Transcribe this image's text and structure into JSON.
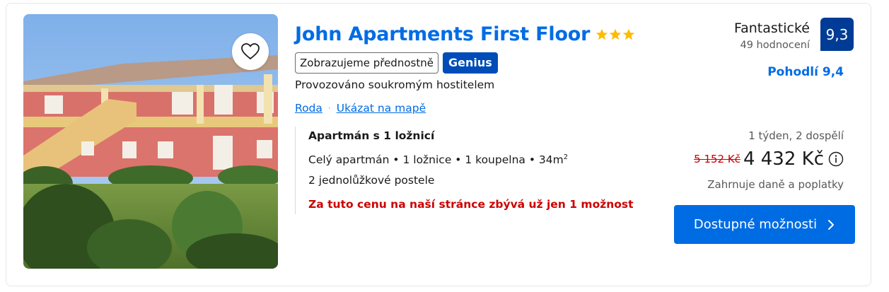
{
  "listing": {
    "title": "John Apartments First Floor",
    "stars": 3,
    "preferred_badge": "Zobrazujeme přednostně",
    "genius_badge": "Genius",
    "host_text": "Provozováno soukromým hostitelem",
    "location_link": "Roda",
    "map_link": "Ukázat na mapě"
  },
  "room": {
    "title": "Apartmán s 1 ložnicí",
    "spec_main": "Celý apartmán • 1 ložnice • 1 koupelna • 34m",
    "spec_sup": "2",
    "beds": "2 jednolůžkové postele",
    "urgency": "Za tuto cenu na naší stránce zbývá už jen 1 možnost"
  },
  "rating": {
    "label": "Fantastické",
    "count": "49 hodnocení",
    "score": "9,3",
    "comfort": "Pohodlí 9,4"
  },
  "pricing": {
    "stay_info": "1 týden, 2 dospělí",
    "old_price": "5 152 Kč",
    "new_price": "4 432 Kč",
    "taxes": "Zahrnuje daně a poplatky"
  },
  "cta": {
    "label": "Dostupné možnosti"
  },
  "colors": {
    "brand_blue": "#006ce4",
    "dark_blue": "#003b95",
    "genius_blue": "#004cb8",
    "star_yellow": "#febb02",
    "urgent_red": "#cc0000"
  },
  "icons": {
    "favorite": "heart-icon",
    "info": "info-icon",
    "cta_arrow": "chevron-right-icon"
  }
}
